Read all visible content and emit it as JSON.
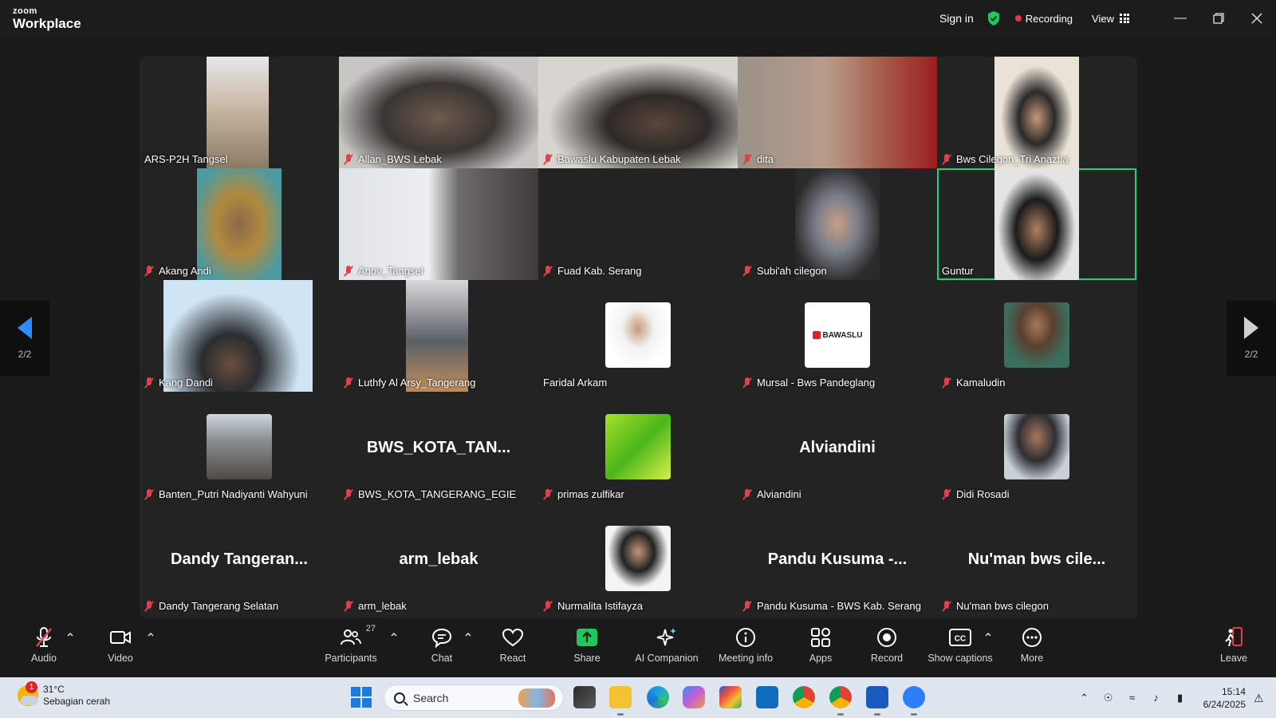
{
  "titlebar": {
    "brand_top": "zoom",
    "brand_bottom": "Workplace",
    "sign_in": "Sign in",
    "recording": "Recording",
    "view": "View"
  },
  "gallery": {
    "page_label": "2/2",
    "active_speaker": "Guntur",
    "tiles": [
      {
        "name": "ARS-P2H Tangsel",
        "muted": false,
        "kind": "video"
      },
      {
        "name": "Allan_BWS Lebak",
        "muted": true,
        "kind": "video"
      },
      {
        "name": "Bawaslu Kabupaten Lebak",
        "muted": true,
        "kind": "video"
      },
      {
        "name": "dita",
        "muted": true,
        "kind": "video"
      },
      {
        "name": "Bws Cilegon_Tri Anaztia",
        "muted": true,
        "kind": "video"
      },
      {
        "name": "Akang Andi",
        "muted": true,
        "kind": "video"
      },
      {
        "name": "Anov_Tangsel",
        "muted": true,
        "kind": "video"
      },
      {
        "name": "Fuad Kab. Serang",
        "muted": true,
        "kind": "blank"
      },
      {
        "name": "Subi'ah cilegon",
        "muted": true,
        "kind": "video"
      },
      {
        "name": "Guntur",
        "muted": false,
        "kind": "video"
      },
      {
        "name": "Kang Dandi",
        "muted": true,
        "kind": "video"
      },
      {
        "name": "Luthfy Al Arsy_Tangerang",
        "muted": true,
        "kind": "video"
      },
      {
        "name": "Faridal Arkam",
        "muted": false,
        "kind": "avatar"
      },
      {
        "name": "Mursal - Bws Pandeglang",
        "muted": true,
        "kind": "logo",
        "logo_text": "BAWASLU"
      },
      {
        "name": "Kamaludin",
        "muted": true,
        "kind": "avatar"
      },
      {
        "name": "Banten_Putri Nadiyanti Wahyuni",
        "muted": true,
        "kind": "avatar"
      },
      {
        "name": "BWS_KOTA_TANGERANG_EGIE",
        "muted": true,
        "kind": "text",
        "display": "BWS_KOTA_TAN..."
      },
      {
        "name": "primas zulfikar",
        "muted": true,
        "kind": "avatar"
      },
      {
        "name": "Alviandini",
        "muted": true,
        "kind": "text",
        "display": "Alviandini"
      },
      {
        "name": "Didi Rosadi",
        "muted": true,
        "kind": "avatar"
      },
      {
        "name": "Dandy Tangerang Selatan",
        "muted": true,
        "kind": "text",
        "display": "Dandy Tangeran..."
      },
      {
        "name": "arm_lebak",
        "muted": true,
        "kind": "text",
        "display": "arm_lebak"
      },
      {
        "name": "Nurmalita Istifayza",
        "muted": true,
        "kind": "avatar"
      },
      {
        "name": "Pandu Kusuma - BWS Kab. Serang",
        "muted": true,
        "kind": "text",
        "display": "Pandu Kusuma -..."
      },
      {
        "name": "Nu'man bws cilegon",
        "muted": true,
        "kind": "text",
        "display": "Nu'man bws cile..."
      }
    ]
  },
  "toolbar": {
    "audio": "Audio",
    "video": "Video",
    "participants": "Participants",
    "participants_count": "27",
    "chat": "Chat",
    "react": "React",
    "share": "Share",
    "ai_companion": "AI Companion",
    "meeting_info": "Meeting info",
    "apps": "Apps",
    "record": "Record",
    "captions": "Show captions",
    "more": "More",
    "leave": "Leave"
  },
  "taskbar": {
    "temp": "31°C",
    "weather": "Sebagian cerah",
    "weather_badge": "1",
    "search": "Search",
    "time": "15:14",
    "date": "6/24/2025"
  },
  "colors": {
    "active_outline": "#1fd17a",
    "recording_dot": "#e8363d",
    "mute_red": "#e0414a",
    "share_green": "#23c55e",
    "page_arrow_blue": "#2f8cff"
  }
}
